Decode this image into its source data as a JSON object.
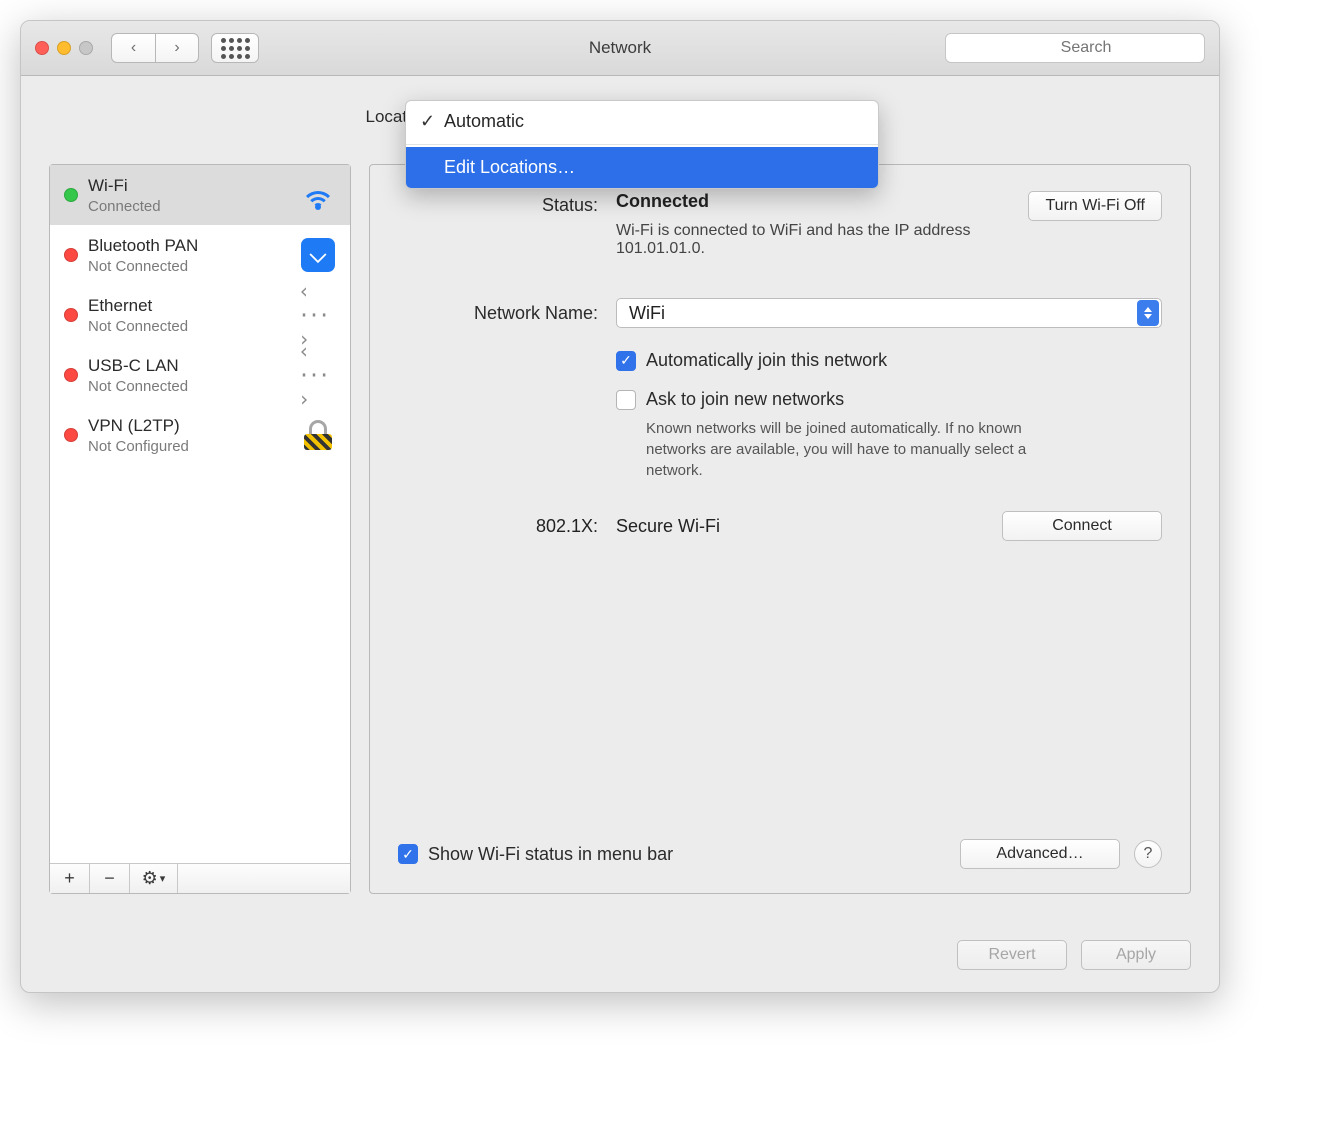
{
  "window": {
    "title": "Network"
  },
  "search": {
    "placeholder": "Search"
  },
  "location": {
    "label": "Location:",
    "options": [
      "Automatic",
      "Edit Locations…"
    ],
    "selected": "Automatic"
  },
  "interfaces": [
    {
      "name": "Wi-Fi",
      "status": "Connected",
      "status_color": "green",
      "icon": "wifi"
    },
    {
      "name": "Bluetooth PAN",
      "status": "Not Connected",
      "status_color": "red",
      "icon": "bluetooth"
    },
    {
      "name": "Ethernet",
      "status": "Not Connected",
      "status_color": "red",
      "icon": "ethernet"
    },
    {
      "name": "USB-C LAN",
      "status": "Not Connected",
      "status_color": "red",
      "icon": "ethernet"
    },
    {
      "name": "VPN (L2TP)",
      "status": "Not Configured",
      "status_color": "red",
      "icon": "vpn"
    }
  ],
  "detail": {
    "status_label": "Status:",
    "status_value": "Connected",
    "status_desc": "Wi-Fi is connected to WiFi and has the IP address 101.01.01.0.",
    "wifi_off_btn": "Turn Wi-Fi Off",
    "network_name_label": "Network Name:",
    "network_name_value": "WiFi",
    "auto_join_label": "Automatically join this network",
    "auto_join_checked": true,
    "ask_join_label": "Ask to join new networks",
    "ask_join_checked": false,
    "ask_join_helper": "Known networks will be joined automatically. If no known networks are available, you will have to manually select a network.",
    "dot1x_label": "802.1X:",
    "dot1x_value": "Secure Wi-Fi",
    "connect_btn": "Connect",
    "show_menu_label": "Show Wi-Fi status in menu bar",
    "show_menu_checked": true,
    "advanced_btn": "Advanced…"
  },
  "footer": {
    "revert": "Revert",
    "apply": "Apply"
  }
}
